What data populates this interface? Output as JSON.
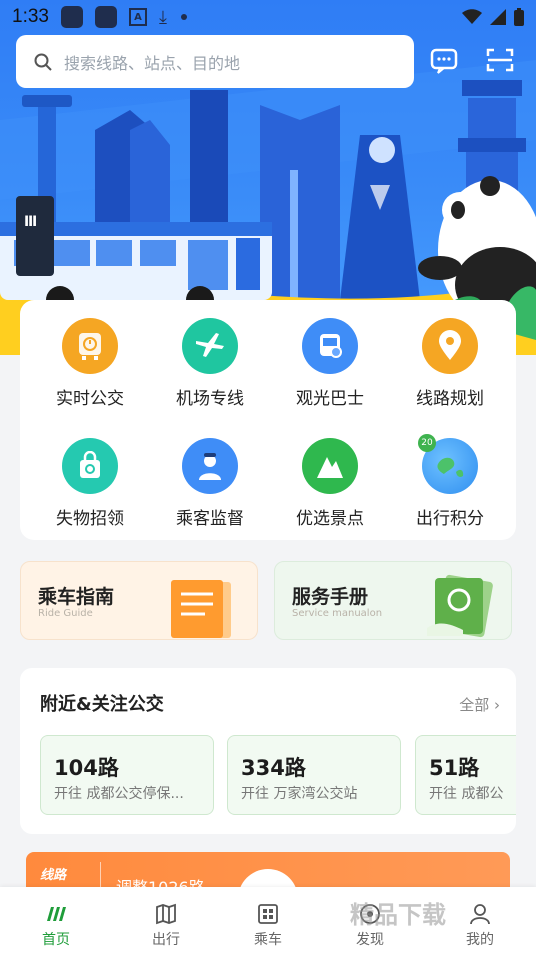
{
  "status_bar": {
    "time": "1:33"
  },
  "search": {
    "placeholder": "搜索线路、站点、目的地"
  },
  "services": [
    {
      "label": "实时公交",
      "icon": "realtime-bus-icon",
      "color": "#f5a623"
    },
    {
      "label": "机场专线",
      "icon": "airport-line-icon",
      "color": "#1fc6a0"
    },
    {
      "label": "观光巴士",
      "icon": "sightseeing-bus-icon",
      "color": "#3f8df7"
    },
    {
      "label": "线路规划",
      "icon": "route-plan-pin-icon",
      "color": "#f5a623"
    },
    {
      "label": "失物招领",
      "icon": "lost-found-bag-icon",
      "color": "#25c9b0"
    },
    {
      "label": "乘客监督",
      "icon": "passenger-supervision-icon",
      "color": "#3f8df7"
    },
    {
      "label": "优选景点",
      "icon": "scenic-mountain-icon",
      "color": "#2fb84e"
    },
    {
      "label": "出行积分",
      "icon": "travel-points-globe-icon",
      "color": "#2f8ef0",
      "badge": "20"
    }
  ],
  "guides": [
    {
      "title": "乘车指南",
      "subtitle": "Ride Guide",
      "bg": "#fff3e6"
    },
    {
      "title": "服务手册",
      "subtitle": "Service manualon",
      "bg": "#eef7ee"
    }
  ],
  "nearby": {
    "title": "附近&关注公交",
    "all_label": "全部",
    "routes": [
      {
        "number": "104路",
        "destination": "开往 成都公交停保..."
      },
      {
        "number": "334路",
        "destination": "开往 万家湾公交站"
      },
      {
        "number": "51路",
        "destination": "开往 成都公"
      }
    ]
  },
  "banner": {
    "tag": "线路",
    "text": "调整1026路"
  },
  "tabs": [
    {
      "label": "首页",
      "icon": "home-icon",
      "active": true
    },
    {
      "label": "出行",
      "icon": "map-icon",
      "active": false
    },
    {
      "label": "乘车",
      "icon": "qr-bus-icon",
      "active": false
    },
    {
      "label": "发现",
      "icon": "discover-icon",
      "active": false
    },
    {
      "label": "我的",
      "icon": "profile-icon",
      "active": false
    }
  ],
  "watermark": "精品下载"
}
